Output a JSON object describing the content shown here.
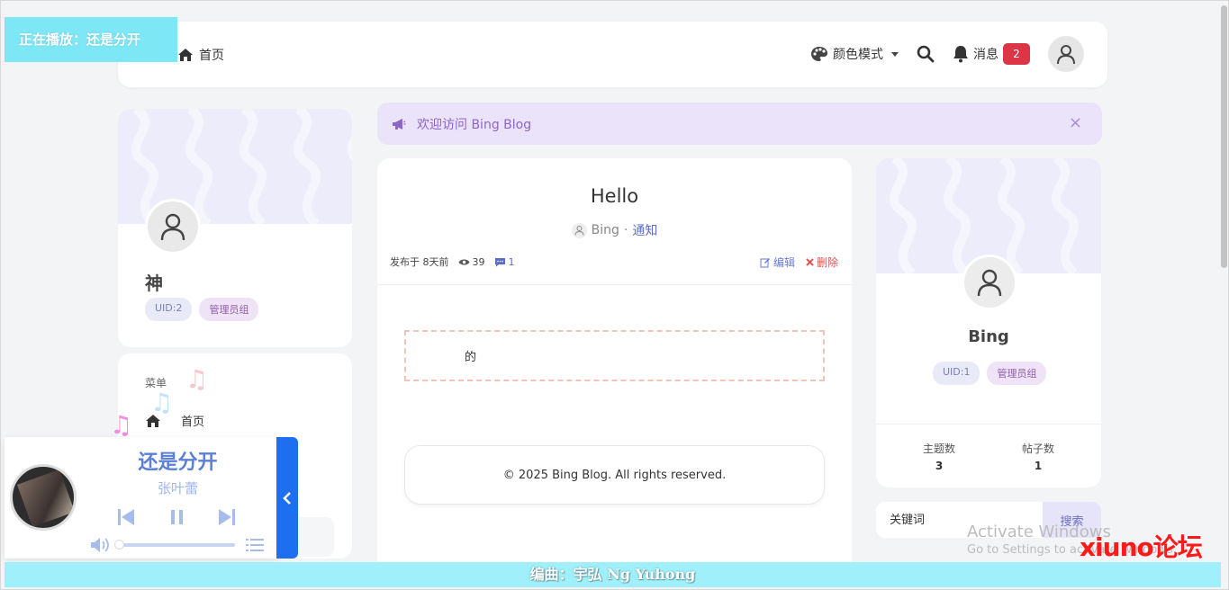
{
  "navbar": {
    "home_label": "首页",
    "color_mode_label": "颜色模式",
    "messages_label": "消息",
    "messages_count": "2"
  },
  "now_playing": {
    "label": "正在播放：还是分开"
  },
  "left_profile": {
    "name": "神",
    "uid_tag": "UID:2",
    "group_tag": "管理员组"
  },
  "left_menu": {
    "title": "菜单",
    "items": [
      {
        "label": "首页",
        "icon": "home-icon"
      }
    ]
  },
  "alert": {
    "text": "欢迎访问 Bing Blog",
    "close": "×"
  },
  "post": {
    "title": "Hello",
    "author": "Bing",
    "separator": "·",
    "category": "通知",
    "published": "发布于 8天前",
    "views": "39",
    "comments": "1",
    "edit_label": "编辑",
    "delete_label": "删除",
    "content": "的",
    "footer": "© 2025 Bing Blog. All rights reserved."
  },
  "right_profile": {
    "name": "Bing",
    "uid_tag": "UID:1",
    "group_tag": "管理员组",
    "stats": [
      {
        "label": "主题数",
        "value": "3"
      },
      {
        "label": "帖子数",
        "value": "1"
      }
    ]
  },
  "search": {
    "placeholder": "关键词",
    "button_label": "搜索"
  },
  "player": {
    "song_title": "还是分开",
    "artist": "张叶蕾",
    "progress_fraction": 0.0,
    "notes": [
      "♫",
      "♫",
      "♫"
    ]
  },
  "lyric": {
    "text": "编曲：宇弘 Ng Yuhong"
  },
  "watermark": {
    "line1": "Activate Windows",
    "line2": "Go to Settings to activate Windows.",
    "brand": "xiuno论坛"
  },
  "colors": {
    "accent": "#5a7fd6",
    "alert_bg": "#ebe3f9",
    "badge_red": "#dc3545",
    "player_toggle": "#1e6ff0"
  }
}
